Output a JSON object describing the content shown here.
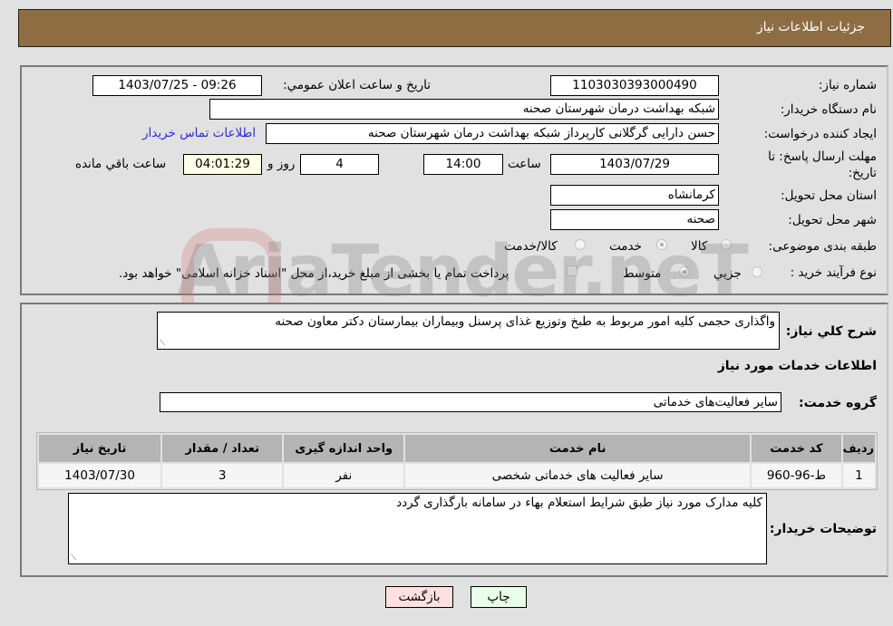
{
  "header": {
    "title": "جزئیات اطلاعات نیاز"
  },
  "details": {
    "need_number_label": "شماره نیاز:",
    "need_number": "1103030393000490",
    "announce_label": "تاریخ و ساعت اعلان عمومي:",
    "announce_value": "1403/07/25 - 09:26",
    "buyer_org_label": "نام دستگاه خريدار:",
    "buyer_org": "شبکه بهداشت درمان شهرستان صحنه",
    "requester_label": "ایجاد کننده درخواست:",
    "requester": "حسن دارایی گرگلانی کارپرداز شبکه بهداشت درمان شهرستان صحنه",
    "contact_link": "اطلاعات تماس خریدار",
    "deadline_label": "مهلت ارسال پاسخ: تا تاریخ:",
    "deadline_date": "1403/07/29",
    "time_label": "ساعت",
    "deadline_time": "14:00",
    "days_value": "4",
    "days_label": "روز و",
    "remaining_time": "04:01:29",
    "remaining_label": "ساعت باقي مانده",
    "province_label": "استان محل تحویل:",
    "province": "کرمانشاه",
    "city_label": "شهر محل تحویل:",
    "city": "صحنه",
    "category_label": "طبقه بندی موضوعی:",
    "category_options": [
      {
        "label": "کالا",
        "checked": false
      },
      {
        "label": "خدمت",
        "checked": true
      },
      {
        "label": "کالا/خدمت",
        "checked": false
      }
    ],
    "process_label": "نوع فرآیند خرید :",
    "process_options": [
      {
        "label": "جزيي",
        "checked": false
      },
      {
        "label": "متوسط",
        "checked": true
      }
    ],
    "treasury_note": "پرداخت تمام یا بخشی از مبلغ خرید،از محل \"اسناد خزانه اسلامی\" خواهد بود.",
    "treasury_checked": false
  },
  "description": {
    "label": "شرح کلي نياز:",
    "text": "واگذاری حجمی کلیه امور مربوط به طبخ وتوزیع غذای پرسنل وبیماران بیمارستان دکتر معاون صحنه"
  },
  "services": {
    "section_title": "اطلاعات خدمات مورد نیاز",
    "group_label": "گروه خدمت:",
    "group_value": "سایر فعالیت‌های خدماتی",
    "columns": [
      "ردیف",
      "کد خدمت",
      "نام خدمت",
      "واحد اندازه گیری",
      "تعداد / مقدار",
      "تاریخ نیاز"
    ],
    "rows": [
      [
        "1",
        "ط-96-960",
        "سایر فعالیت های خدماتی شخصی",
        "نفر",
        "3",
        "1403/07/30"
      ]
    ]
  },
  "buyer_notes": {
    "label": "توضیحات خریدار:",
    "text": "کلیه مدارک مورد نیاز طبق شرایط استعلام بهاء در سامانه بارگذاری گردد"
  },
  "buttons": {
    "print": "چاپ",
    "back": "بازگشت"
  },
  "colors": {
    "header_bg": "#8e6d43",
    "print_bg": "#eaffea",
    "back_bg": "#ffe0e0",
    "link": "#2b2bd6"
  },
  "watermark": "AriaTender.neT"
}
